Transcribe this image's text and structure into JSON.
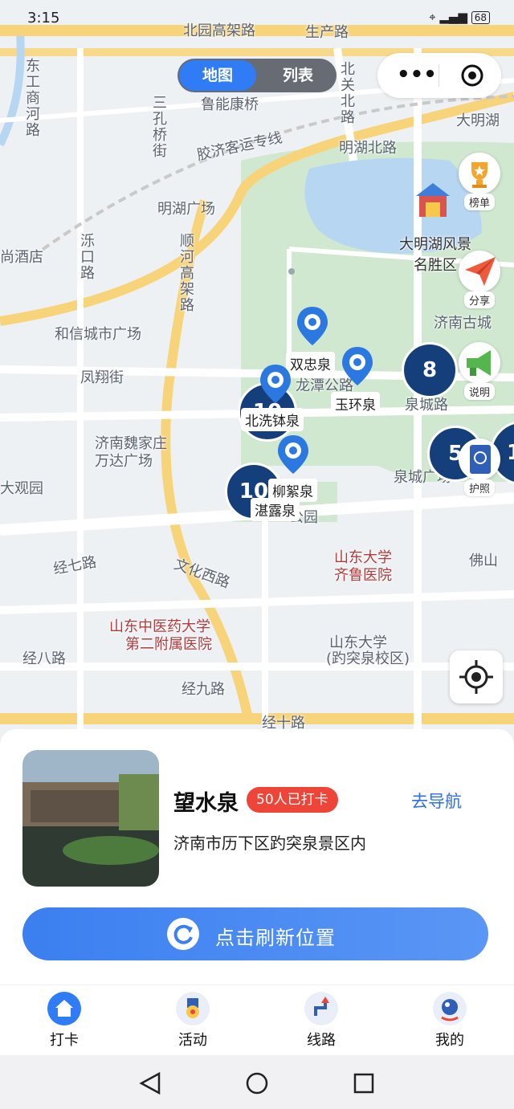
{
  "status_bar": {
    "time": "3:15",
    "battery": "68"
  },
  "view_toggle": {
    "map": "地图",
    "list": "列表"
  },
  "side_buttons": {
    "ranking": "榜单",
    "share": "分享",
    "guide": "说明",
    "passport": "护照"
  },
  "map_labels": {
    "beiyuan": "北园高架路",
    "shengchan": "生产路",
    "luneng": "鲁能康桥",
    "daming_top": "大明湖",
    "jiaoji": "胶济客运专线",
    "minghu_n": "明湖北路",
    "minghu_sq": "明湖广场",
    "shunhe": "顺河高架路",
    "scenic": "大明湖风景名胜区",
    "gucheng": "济南古城",
    "hexin": "和信城市广场",
    "fengxiang": "凤翔街",
    "longtan": "龙潭公路",
    "quancheng_rd": "泉城路",
    "wanda1": "济南魏家庄",
    "wanda2": "万达广场",
    "quancheng_sq": "泉城广场",
    "daguan": "大观园",
    "jingqi": "经七路",
    "wenhua": "文化西路",
    "qilu1": "山东大学",
    "qilu2": "齐鲁医院",
    "tcm1": "山东中医药大学",
    "tcm2": "第二附属医院",
    "sdu1": "山东大学",
    "sdu2": "(趵突泉校区)",
    "jingba": "经八路",
    "jingjiu": "经九路",
    "jingshi": "经十路",
    "foshan": "佛山",
    "sankong": "三孔桥街",
    "dongGong": "东工商河路",
    "jiudian": "尚酒店",
    "beiguan": "北关北路",
    "luokou": "泺口路",
    "park": "公园"
  },
  "pins": {
    "shuangzhong": "双忠泉",
    "yuhuan": "玉环泉",
    "beixi": "北洗钵泉",
    "liuxu": "柳絮泉",
    "zhanlu": "湛露泉"
  },
  "clusters": {
    "c8": "8",
    "c10a": "10",
    "c10b": "10",
    "c5": "5",
    "c1": "1"
  },
  "spot": {
    "name": "望水泉",
    "checkins": "50人已打卡",
    "navigate": "去导航",
    "address": "济南市历下区趵突泉景区内"
  },
  "refresh_button": "点击刷新位置",
  "tabs": [
    {
      "label": "打卡"
    },
    {
      "label": "活动"
    },
    {
      "label": "线路"
    },
    {
      "label": "我的"
    }
  ],
  "colors": {
    "accent": "#2f7cf6",
    "badge": "#ef4438",
    "cluster": "#153f7a",
    "park": "#cfe8cf",
    "water": "#b7d6f2"
  }
}
